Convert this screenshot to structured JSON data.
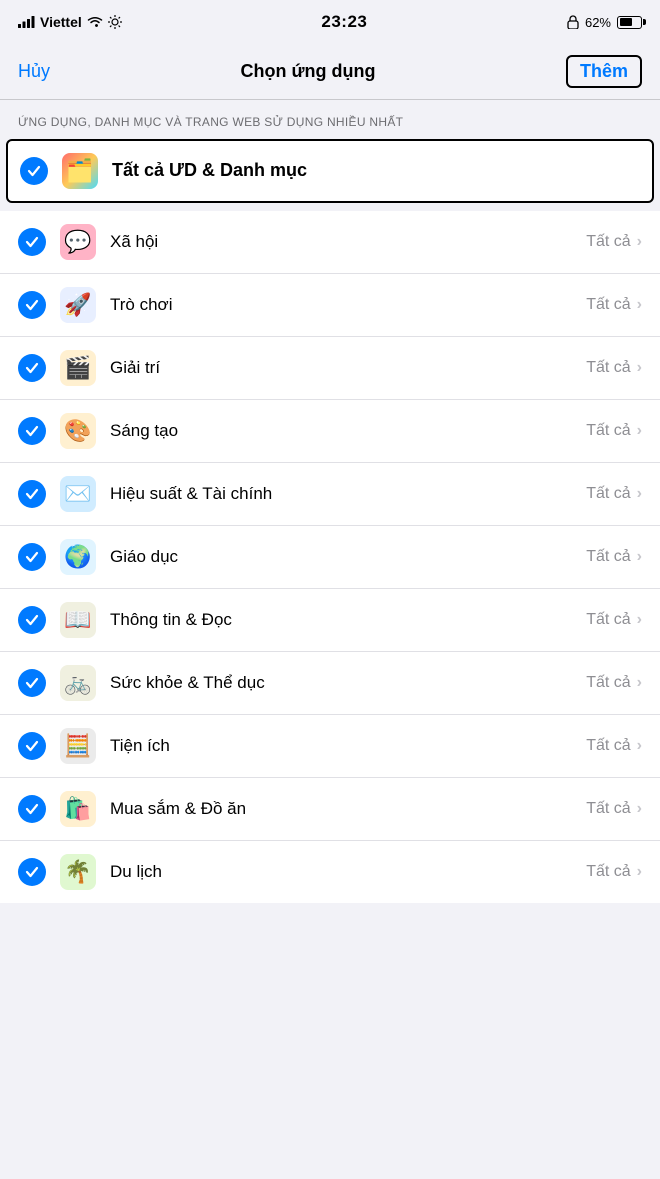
{
  "statusBar": {
    "carrier": "Viettel",
    "time": "23:23",
    "battery": "62%"
  },
  "nav": {
    "cancel": "Hủy",
    "title": "Chọn ứng dụng",
    "add": "Thêm"
  },
  "sectionHeader": "ỨNG DỤNG, DANH MỤC VÀ TRANG WEB SỬ DỤNG\nNHIỀU NHẤT",
  "allApps": {
    "label": "Tất cả ƯD & Danh mục",
    "icon": "🗂️"
  },
  "categories": [
    {
      "name": "Xã hội",
      "icon": "💬",
      "right": "Tất cả",
      "bg": "#ffb3c6"
    },
    {
      "name": "Trò chơi",
      "icon": "🚀",
      "right": "Tất cả",
      "bg": "#e8f0ff"
    },
    {
      "name": "Giải trí",
      "icon": "🎬",
      "right": "Tất cả",
      "bg": "#fff0e0"
    },
    {
      "name": "Sáng tạo",
      "icon": "🎨",
      "right": "Tất cả",
      "bg": "#fff0e0"
    },
    {
      "name": "Hiệu suất & Tài chính",
      "icon": "📨",
      "right": "Tất cả",
      "bg": "#e0f0ff"
    },
    {
      "name": "Giáo dục",
      "icon": "🌍",
      "right": "Tất cả",
      "bg": "#e0f4ff"
    },
    {
      "name": "Thông tin & Đọc",
      "icon": "📖",
      "right": "Tất cả",
      "bg": "#f0f0e8"
    },
    {
      "name": "Sức khỏe & Thể dục",
      "icon": "🚲",
      "right": "Tất cả",
      "bg": "#f0f0e8"
    },
    {
      "name": "Tiện ích",
      "icon": "🧮",
      "right": "Tất cả",
      "bg": "#f0f0f0"
    },
    {
      "name": "Mua sắm & Đồ ăn",
      "icon": "🛍️",
      "right": "Tất cả",
      "bg": "#fff0e0"
    },
    {
      "name": "Du lịch",
      "icon": "🌴",
      "right": "Tất cả",
      "bg": "#e8f8e0"
    }
  ]
}
